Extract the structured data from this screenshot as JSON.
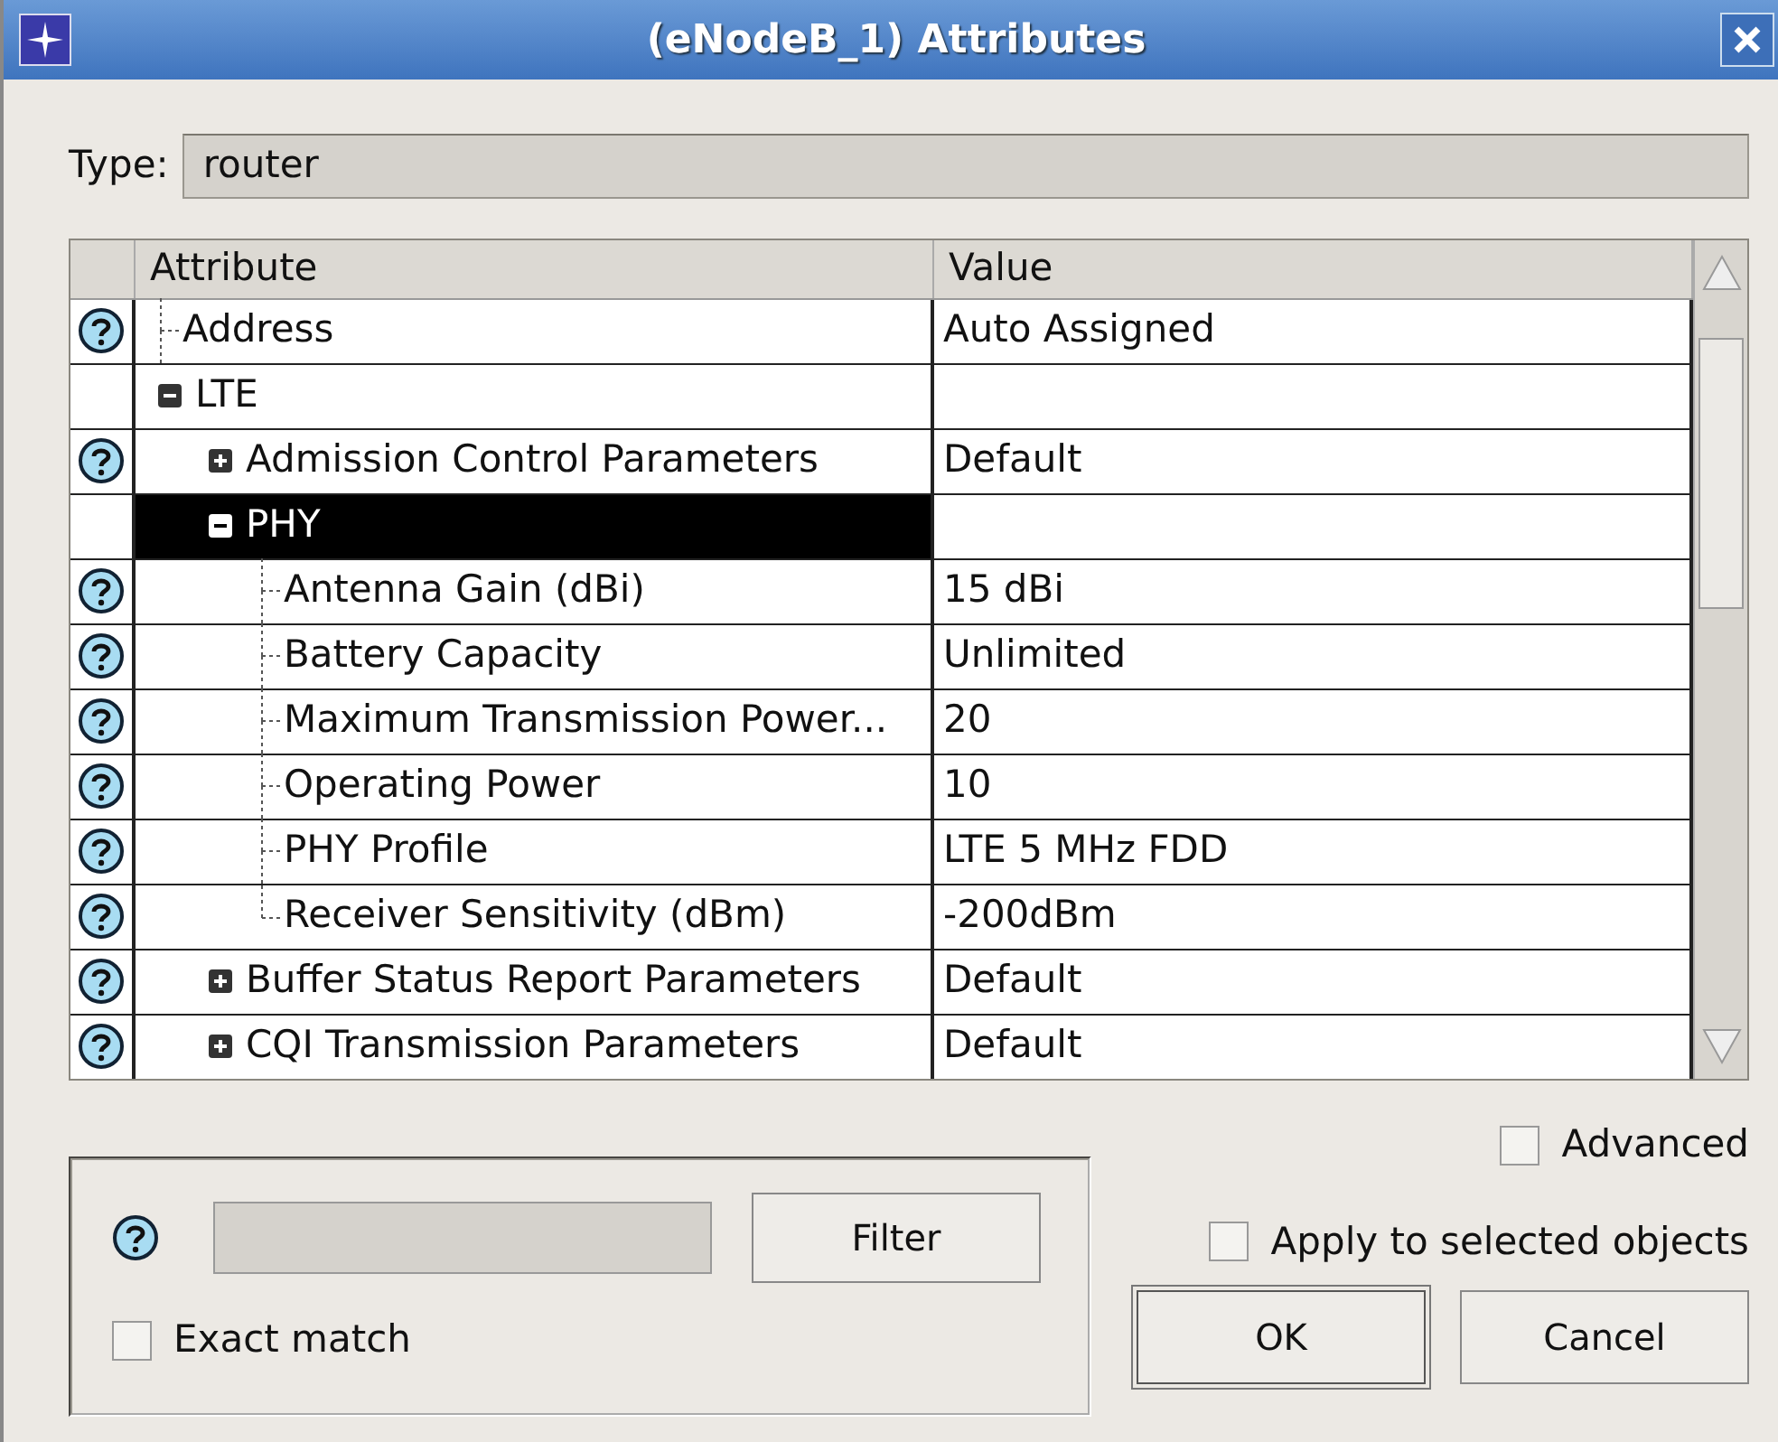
{
  "window": {
    "title": "(eNodeB_1) Attributes"
  },
  "type_field": {
    "label": "Type:",
    "value": "router"
  },
  "table": {
    "columns": [
      "Attribute",
      "Value"
    ],
    "rows": [
      {
        "name": "Address",
        "value": "Auto Assigned",
        "has_help": true,
        "selected": false
      },
      {
        "name": "LTE",
        "has_help": false,
        "selected": false,
        "expanded": true,
        "children": [
          {
            "name": "Admission Control Parameters",
            "value": "Default",
            "has_help": true,
            "selected": false,
            "expanded": false
          },
          {
            "name": "PHY",
            "has_help": false,
            "selected": true,
            "expanded": true,
            "children": [
              {
                "name": "Antenna Gain (dBi)",
                "value": "15 dBi",
                "has_help": true,
                "selected": false
              },
              {
                "name": "Battery Capacity",
                "value": "Unlimited",
                "has_help": true,
                "selected": false
              },
              {
                "name": "Maximum Transmission Power...",
                "value": "20",
                "has_help": true,
                "selected": false
              },
              {
                "name": "Operating Power",
                "value": "10",
                "has_help": true,
                "selected": false
              },
              {
                "name": "PHY Profile",
                "value": "LTE 5 MHz FDD",
                "has_help": true,
                "selected": false
              },
              {
                "name": "Receiver Sensitivity (dBm)",
                "value": "-200dBm",
                "has_help": true,
                "selected": false
              }
            ]
          },
          {
            "name": "Buffer Status Report Parameters",
            "value": "Default",
            "has_help": true,
            "selected": false,
            "expanded": false
          },
          {
            "name": "CQI Transmission Parameters",
            "value": "Default",
            "has_help": true,
            "selected": false,
            "expanded": false
          }
        ]
      }
    ]
  },
  "filter": {
    "button": {
      "label": "Filter"
    },
    "exact_match": {
      "label": "Exact match",
      "checked": false
    }
  },
  "advanced": {
    "label": "Advanced",
    "checked": false
  },
  "apply_selected": {
    "label": "Apply to selected objects",
    "checked": false
  },
  "buttons": [
    {
      "label": "OK",
      "default": true
    },
    {
      "label": "Cancel",
      "default": false
    }
  ]
}
